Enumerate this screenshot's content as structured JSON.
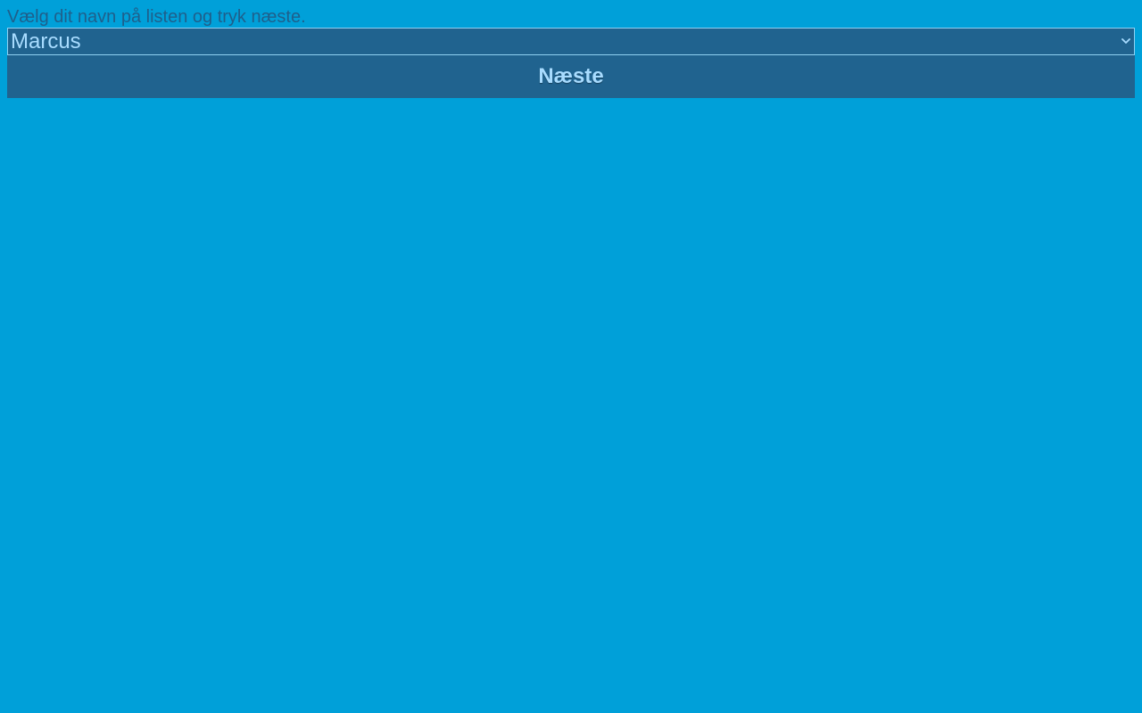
{
  "colors": {
    "background": "#00a0d9",
    "control_bg": "#20638f",
    "control_text": "#a8dcff",
    "prompt_text": "#1f5f8b"
  },
  "form": {
    "prompt": "Vælg dit navn på listen og tryk næste.",
    "name_select": {
      "selected": "Marcus",
      "icon": "chevron-down-icon"
    },
    "next_label": "Næste"
  }
}
